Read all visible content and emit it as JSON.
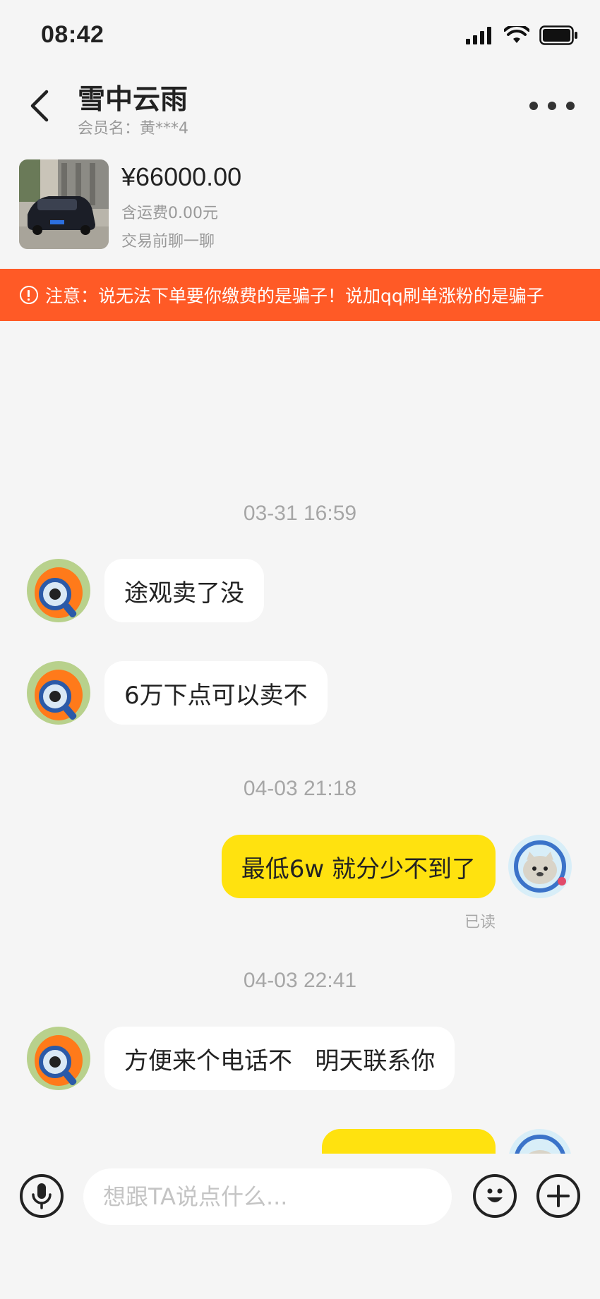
{
  "status_bar": {
    "time": "08:42"
  },
  "header": {
    "title": "雪中云雨",
    "subtitle": "会员名：黄***4"
  },
  "product": {
    "price": "¥66000.00",
    "shipping": "含运费0.00元",
    "chat_before": "交易前聊一聊"
  },
  "warning": {
    "text": "注意：说无法下单要你缴费的是骗子！说加qq刷单涨粉的是骗子"
  },
  "messages": [
    {
      "timestamp": "03-31 16:59"
    },
    {
      "from": "other",
      "text": "途观卖了没"
    },
    {
      "from": "other",
      "text": "6万下点可以卖不"
    },
    {
      "timestamp": "04-03 21:18"
    },
    {
      "from": "me",
      "text": "最低6w 就分少不到了",
      "status": "已读"
    },
    {
      "timestamp": "04-03 22:41"
    },
    {
      "from": "other",
      "text": "方便来个电话不   明天联系你"
    }
  ],
  "input": {
    "placeholder": "想跟TA说点什么..."
  },
  "colors": {
    "accent": "#ffe20f",
    "warning": "#ff5a26",
    "background": "#f5f5f5"
  },
  "icons": [
    "back-icon",
    "more-icon",
    "microphone-icon",
    "emoji-icon",
    "plus-icon",
    "warning-icon"
  ]
}
